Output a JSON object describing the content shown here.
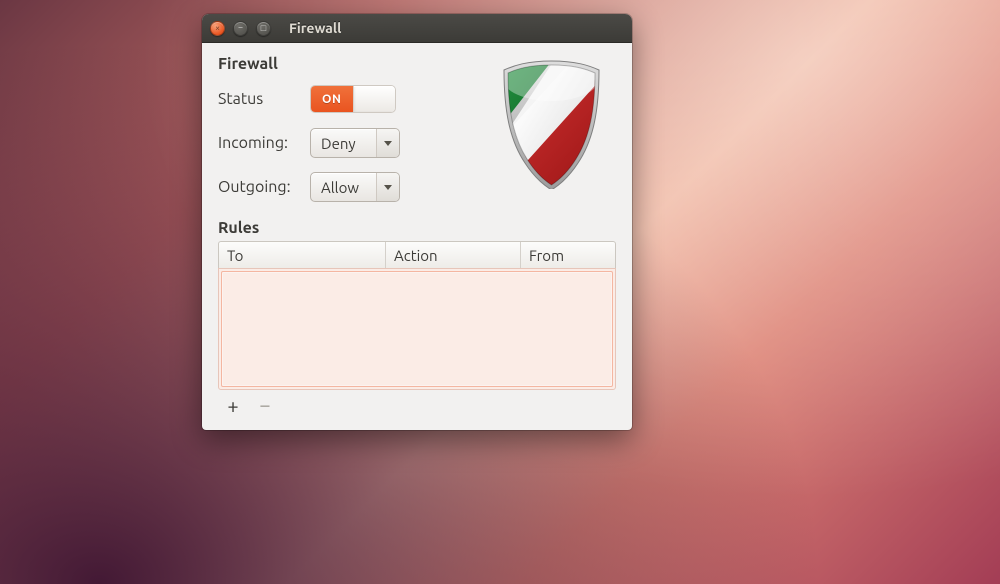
{
  "window": {
    "title": "Firewall"
  },
  "firewall": {
    "section_label": "Firewall",
    "status_label": "Status",
    "status_value": "ON",
    "incoming_label": "Incoming:",
    "incoming_value": "Deny",
    "outgoing_label": "Outgoing:",
    "outgoing_value": "Allow"
  },
  "rules": {
    "section_label": "Rules",
    "columns": {
      "to": "To",
      "action": "Action",
      "from": "From"
    },
    "rows": []
  },
  "toolbar": {
    "add_label": "+",
    "remove_label": "−"
  },
  "colors": {
    "accent": "#e95420",
    "shield_green": "#127a2e",
    "shield_red": "#bf1b1b",
    "shield_white": "#f5f5f5"
  }
}
